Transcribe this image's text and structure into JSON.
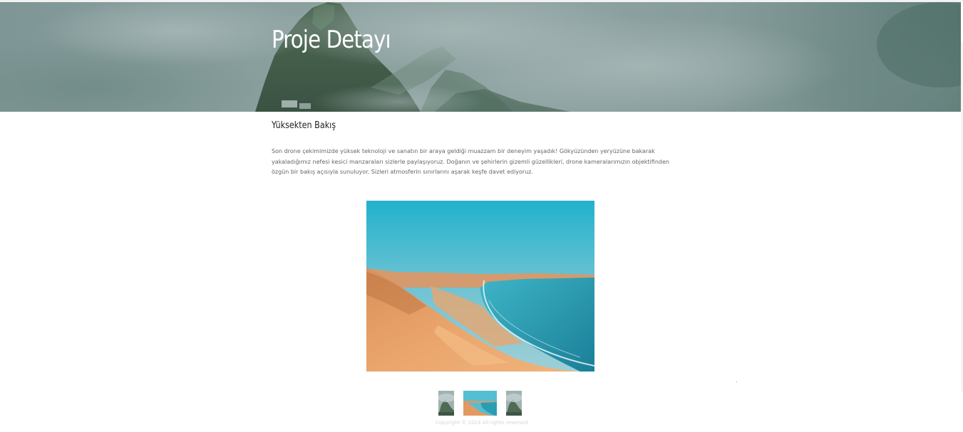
{
  "hero": {
    "title": "Proje Detayı"
  },
  "project": {
    "section_title": "Yüksekten Bakış",
    "description": "Son drone çekimimizde yüksek teknoloji ve sanatın bir araya geldiği muazzam bir deneyim yaşadık! Gökyüzünden yeryüzüne bakarak yakaladığımız nefesi kesici manzaraları sizlerle paylaşıyoruz. Doğanın ve şehirlerin gizemli güzellikleri, drone kameralarımızın objektifinden özgün bir bakış açısıyla sunuluyor. Sizleri atmosferin sınırlarını aşarak keşfe davet ediyoruz."
  },
  "gallery": {
    "main_image": "desert-coast-photo",
    "thumbnails": [
      {
        "image": "misty-mountain-photo"
      },
      {
        "image": "desert-coast-photo",
        "selected": true
      },
      {
        "image": "misty-mountain-photo"
      }
    ]
  },
  "footer": {
    "copyright": "Copyright © 2024 All rights reserved"
  },
  "colors": {
    "hero_overlay": "#8aa09f",
    "sky": "#3fb4cc",
    "sand": "#e8a26a",
    "sea": "#2a9db5"
  }
}
